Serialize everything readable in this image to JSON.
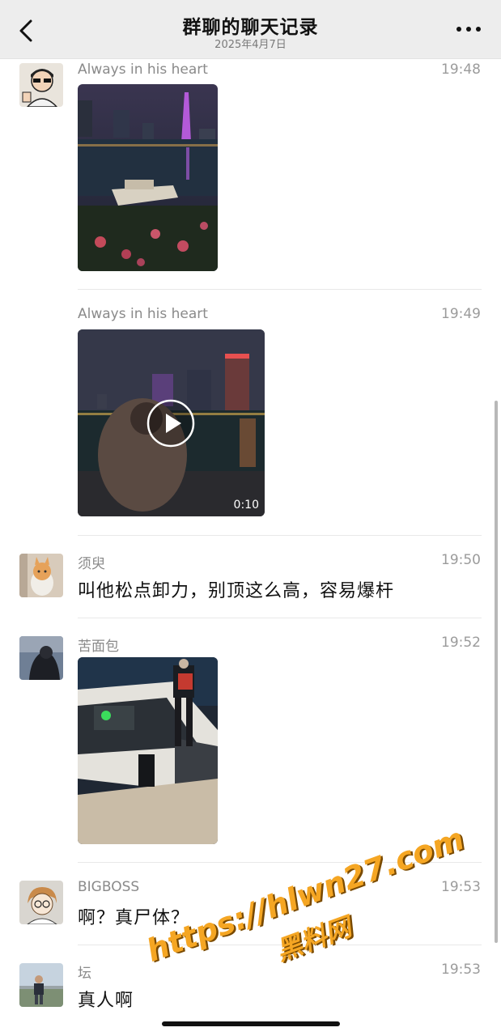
{
  "nav": {
    "title": "群聊的聊天记录",
    "date": "2025年4月7日",
    "back_icon": "chevron-left-icon",
    "more_icon": "more-icon"
  },
  "messages": [
    {
      "sender": "Always in his heart",
      "time": "19:48",
      "type": "image"
    },
    {
      "sender": "Always in his heart",
      "time": "19:49",
      "type": "video",
      "duration": "0:10"
    },
    {
      "sender": "须臾",
      "time": "19:50",
      "type": "text",
      "text": "叫他松点卸力，别顶这么高，容易爆杆"
    },
    {
      "sender": "苦面包",
      "time": "19:52",
      "type": "image"
    },
    {
      "sender": "BIGBOSS",
      "time": "19:53",
      "type": "text",
      "text": "啊？真尸体？"
    },
    {
      "sender": "坛",
      "time": "19:53",
      "type": "text",
      "text": "真人啊"
    }
  ],
  "watermark": {
    "url": "https://hlwn27.com",
    "cn": "黑料网"
  },
  "colors": {
    "nav_bg": "#ededed",
    "watermark": "#f5a623",
    "meta_text": "#9b9b9b"
  }
}
